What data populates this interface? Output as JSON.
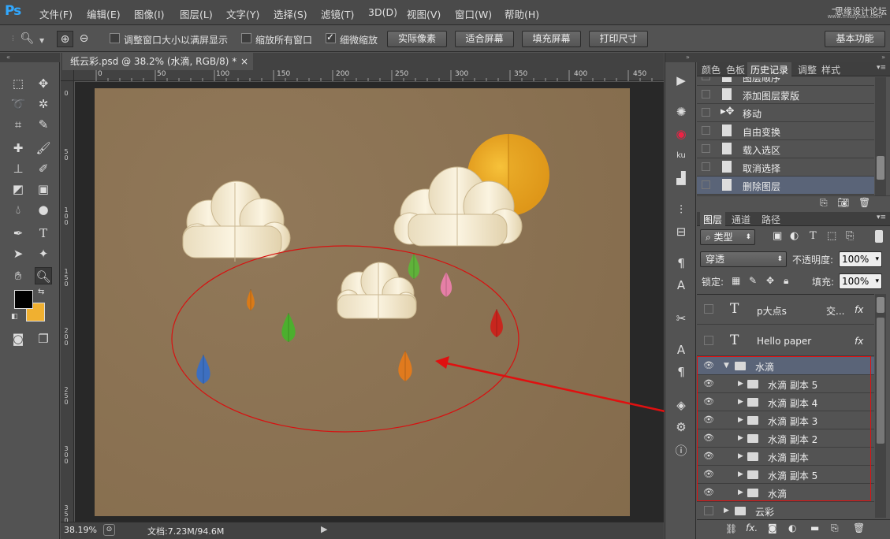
{
  "app": {
    "logo": "Ps"
  },
  "menu": [
    "文件(F)",
    "编辑(E)",
    "图像(I)",
    "图层(L)",
    "文字(Y)",
    "选择(S)",
    "滤镜(T)",
    "3D(D)",
    "视图(V)",
    "窗口(W)",
    "帮助(H)"
  ],
  "watermark": {
    "main": "思缘设计论坛",
    "sub": "www.missyuan.com"
  },
  "window_controls": {
    "minimize": "–",
    "maximize": "□",
    "close": "✕"
  },
  "options": {
    "resize_windows": "调整窗口大小以满屏显示",
    "zoom_all": "缩放所有窗口",
    "scrubby_zoom": "细微缩放",
    "scrubby_checked": true,
    "actual_pixels": "实际像素",
    "fit_screen": "适合屏幕",
    "fill_screen": "填充屏幕",
    "print_size": "打印尺寸",
    "workspace": "基本功能"
  },
  "document": {
    "tab_title": "纸云彩.psd @ 38.2% (水滴, RGB/8) *",
    "close": "×",
    "ruler_top": [
      "0",
      "50",
      "100",
      "150",
      "200",
      "250",
      "300",
      "350",
      "400",
      "450"
    ],
    "ruler_left": [
      "0",
      "50",
      "100",
      "150",
      "200",
      "250",
      "300",
      "350"
    ],
    "zoom": "38.19%",
    "doc_size": "文档:7.23M/94.6M",
    "canvas_color": "#8b7150"
  },
  "panel_tabs_top": [
    "颜色",
    "色板",
    "历史记录",
    "调整",
    "样式"
  ],
  "history": [
    "图层顺序",
    "添加图层蒙版",
    "移动",
    "自由变换",
    "载入选区",
    "取消选择",
    "删除图层"
  ],
  "panel_tabs_layers": [
    "图层",
    "通道",
    "路径"
  ],
  "layers_panel": {
    "filter_kind": "类型",
    "blend_mode": "穿透",
    "opacity_label": "不透明度:",
    "opacity": "100%",
    "lock_label": "锁定:",
    "fill_label": "填充:",
    "fill": "100%"
  },
  "layers": [
    {
      "name": "p大点s",
      "type": "text",
      "extra": "交...",
      "fx": "fx",
      "visible": false
    },
    {
      "name": "Hello paper",
      "type": "text",
      "fx": "fx",
      "visible": false
    },
    {
      "name": "水滴",
      "type": "group-open",
      "visible": true,
      "selected": true
    },
    {
      "name": "水滴 副本 5",
      "type": "group",
      "visible": true
    },
    {
      "name": "水滴 副本 4",
      "type": "group",
      "visible": true
    },
    {
      "name": "水滴 副本 3",
      "type": "group",
      "visible": true
    },
    {
      "name": "水滴 副本 2",
      "type": "group",
      "visible": true
    },
    {
      "name": "水滴 副本",
      "type": "group",
      "visible": true
    },
    {
      "name": "水滴 副本 5",
      "type": "group",
      "visible": true
    },
    {
      "name": "水滴",
      "type": "group",
      "visible": true
    },
    {
      "name": "云彩",
      "type": "group",
      "visible": false
    }
  ],
  "colors": {
    "accent_red": "#e01010",
    "foreground": "#000000",
    "background": "#f0b030",
    "selection": "#5a6478"
  }
}
